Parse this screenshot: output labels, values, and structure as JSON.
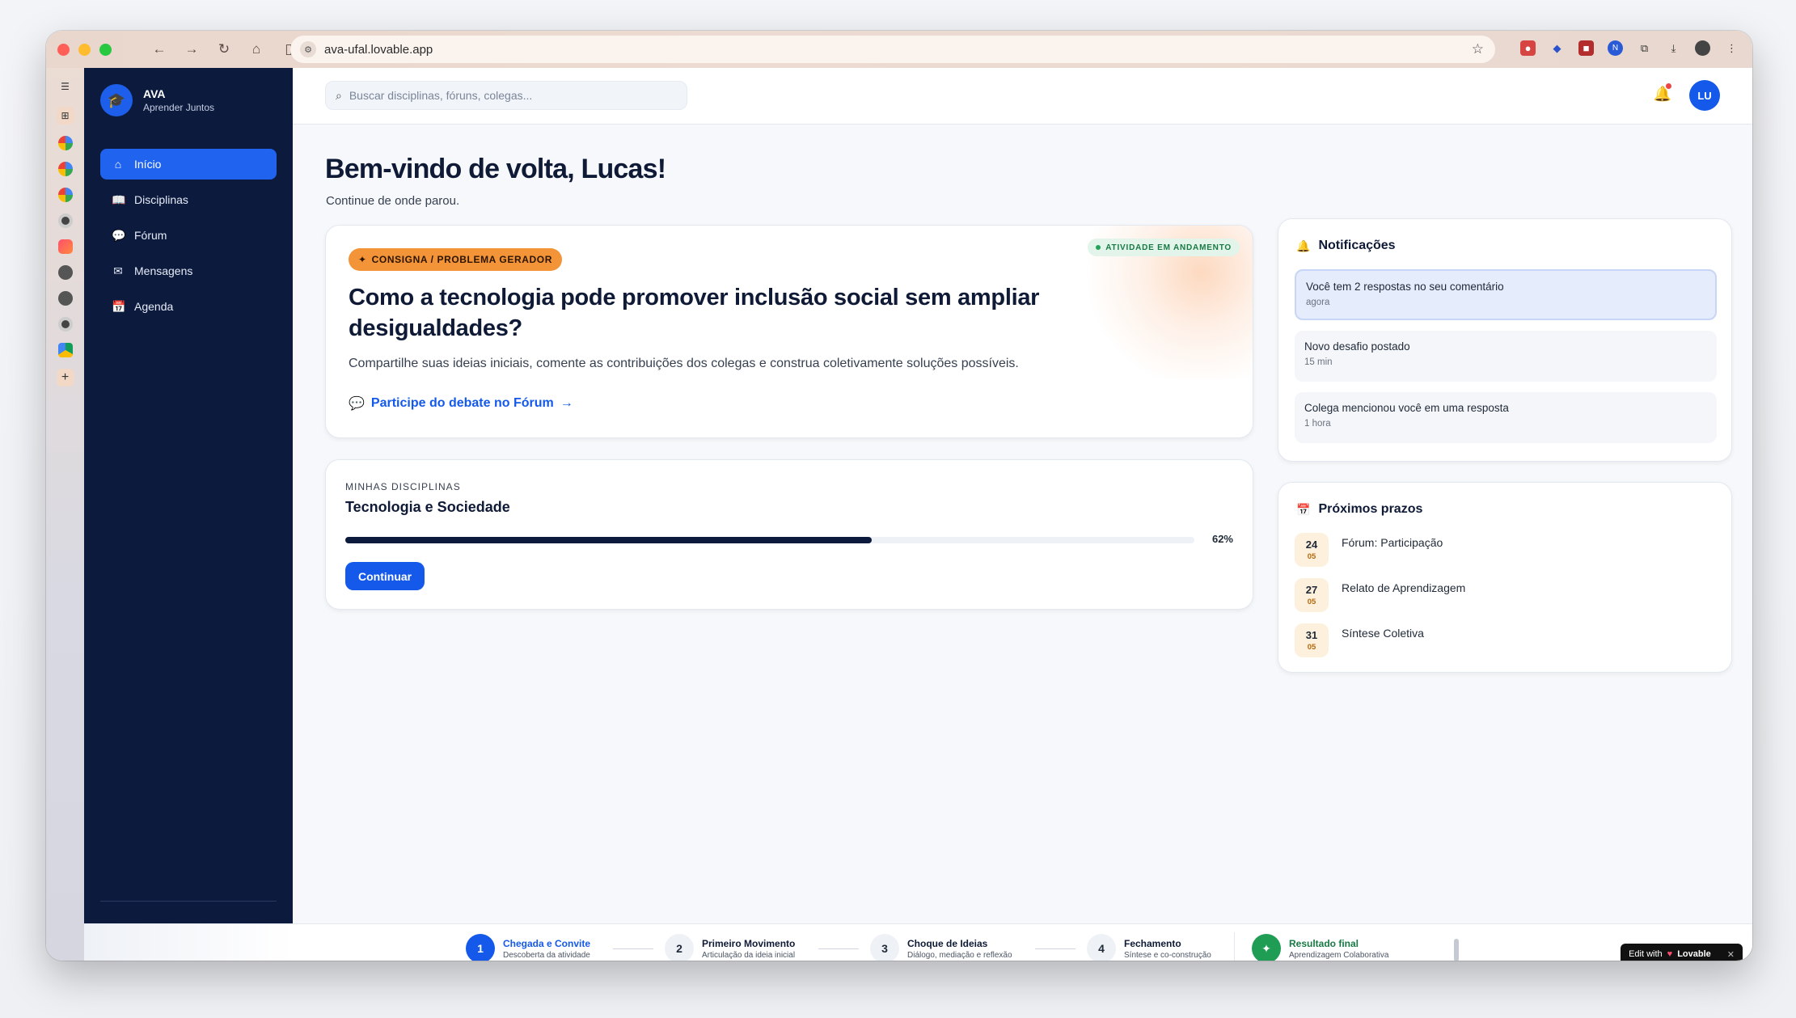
{
  "browser": {
    "url": "ava-ufal.lovable.app"
  },
  "brand": {
    "name": "AVA",
    "tagline": "Aprender Juntos"
  },
  "sidebar": {
    "items": [
      {
        "label": "Início",
        "icon": "home-icon"
      },
      {
        "label": "Disciplinas",
        "icon": "book-icon"
      },
      {
        "label": "Fórum",
        "icon": "chat-icon"
      },
      {
        "label": "Mensagens",
        "icon": "mail-icon"
      },
      {
        "label": "Agenda",
        "icon": "calendar-icon"
      }
    ]
  },
  "topbar": {
    "search_placeholder": "Buscar disciplinas, fóruns, colegas...",
    "avatar_initials": "LU"
  },
  "welcome": {
    "title": "Bem-vindo de volta, Lucas!",
    "subtitle": "Continue de onde parou."
  },
  "hero": {
    "badge": "CONSIGNA / PROBLEMA GERADOR",
    "status": "ATIVIDADE EM ANDAMENTO",
    "title": "Como a tecnologia pode promover inclusão social sem ampliar desigualdades?",
    "description": "Compartilhe suas ideias iniciais, comente as contribuições dos colegas e construa coletivamente soluções possíveis.",
    "link": "Participe do debate no Fórum"
  },
  "course": {
    "eyebrow": "MINHAS DISCIPLINAS",
    "title": "Tecnologia e Sociedade",
    "progress_percent": 62,
    "progress_label": "62%",
    "button": "Continuar"
  },
  "notifications": {
    "title": "Notificações",
    "items": [
      {
        "text": "Você tem 2 respostas no seu comentário",
        "time": "agora",
        "unread": true
      },
      {
        "text": "Novo desafio postado",
        "time": "15 min",
        "unread": false
      },
      {
        "text": "Colega mencionou você em uma resposta",
        "time": "1 hora",
        "unread": false
      }
    ]
  },
  "deadlines": {
    "title": "Próximos prazos",
    "items": [
      {
        "day": "24",
        "month": "05",
        "label": "Fórum: Participação"
      },
      {
        "day": "27",
        "month": "05",
        "label": "Relato de Aprendizagem"
      },
      {
        "day": "31",
        "month": "05",
        "label": "Síntese Coletiva"
      }
    ]
  },
  "stepper": {
    "steps": [
      {
        "num": "1",
        "title": "Chegada e Convite",
        "sub": "Descoberta da atividade"
      },
      {
        "num": "2",
        "title": "Primeiro Movimento",
        "sub": "Articulação da ideia inicial"
      },
      {
        "num": "3",
        "title": "Choque de Ideias",
        "sub": "Diálogo, mediação e reflexão"
      },
      {
        "num": "4",
        "title": "Fechamento",
        "sub": "Síntese e co-construção"
      }
    ],
    "final": {
      "title": "Resultado final",
      "sub": "Aprendizagem Colaborativa"
    }
  },
  "lovable": {
    "prefix": "Edit with",
    "brand": "Lovable"
  },
  "colors": {
    "sidebar_bg": "#0c1a3d",
    "primary": "#1459ea",
    "accent_orange": "#f29437",
    "success": "#1f9d55"
  }
}
